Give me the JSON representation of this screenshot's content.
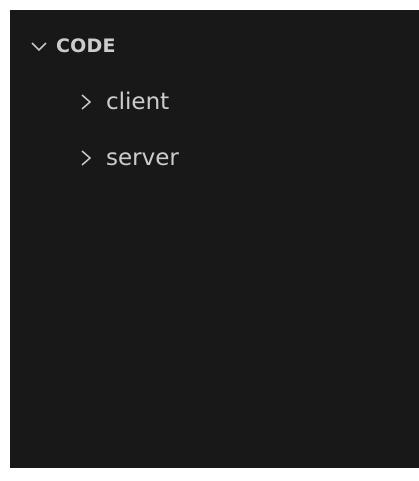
{
  "explorer": {
    "section": {
      "title": "CODE",
      "expanded": true,
      "icon": "chevron-down-icon"
    },
    "folders": [
      {
        "label": "client",
        "expanded": false,
        "icon": "chevron-right-icon"
      },
      {
        "label": "server",
        "expanded": false,
        "icon": "chevron-right-icon"
      }
    ]
  },
  "colors": {
    "background": "#181818",
    "text": "#cccccc"
  }
}
